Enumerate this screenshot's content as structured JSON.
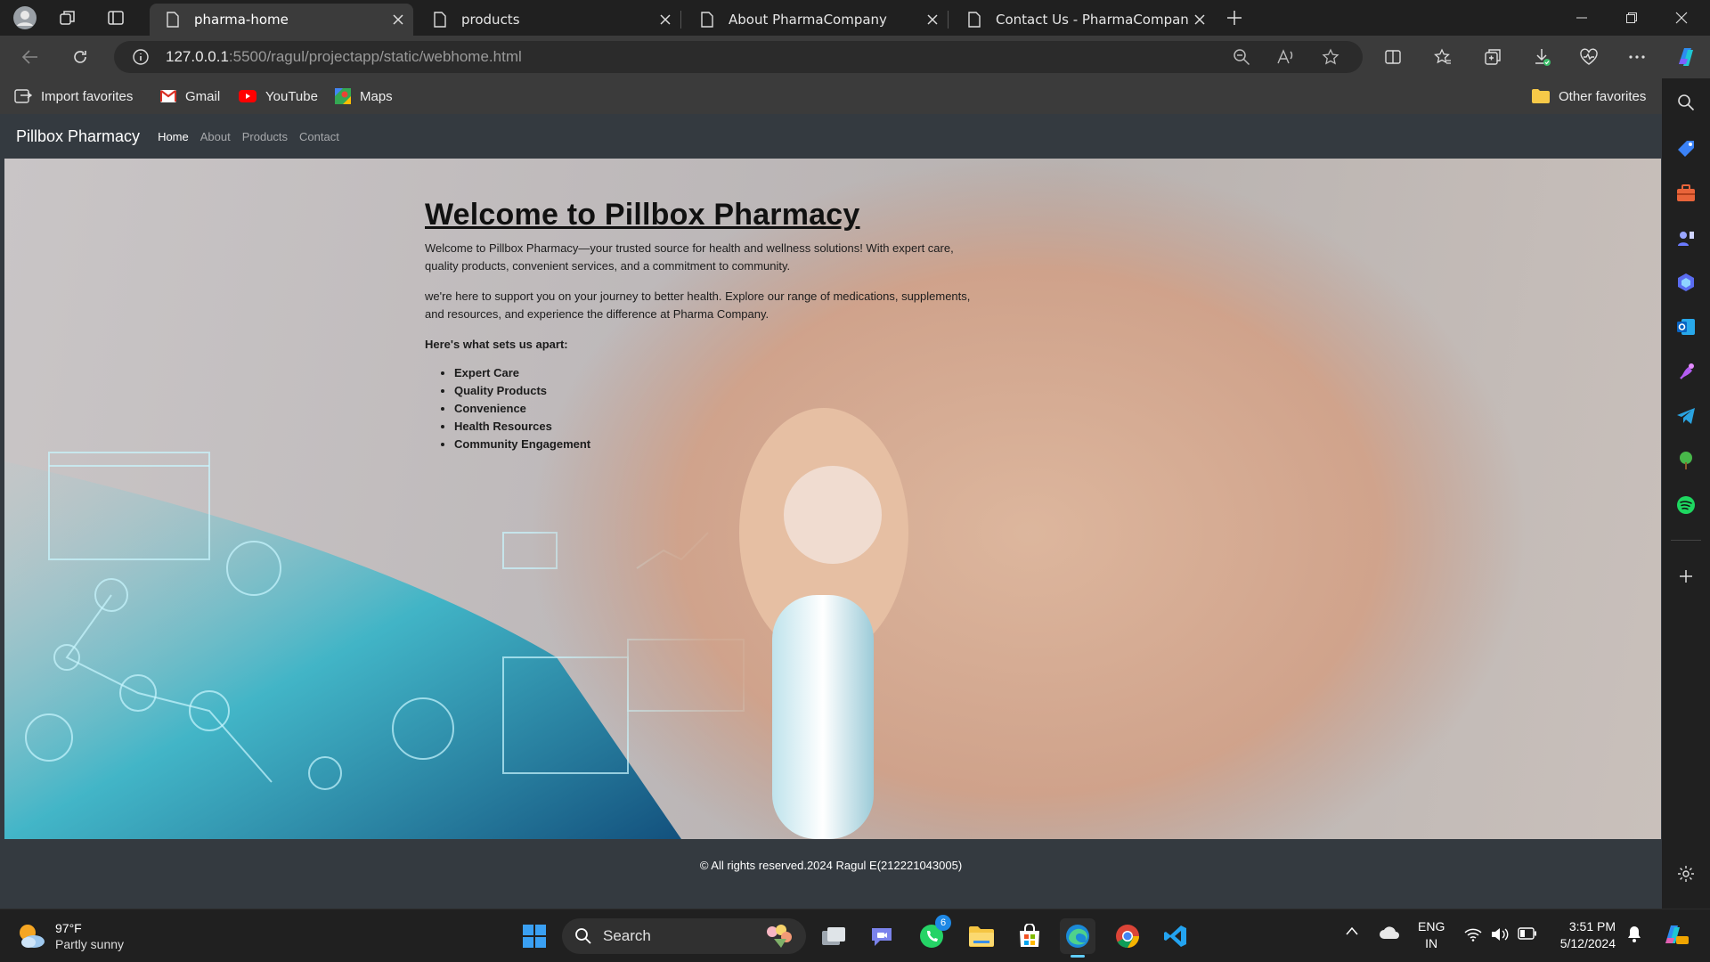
{
  "browser": {
    "tabs": [
      {
        "title": "pharma-home",
        "active": true
      },
      {
        "title": "products",
        "active": false
      },
      {
        "title": "About PharmaCompany",
        "active": false
      },
      {
        "title": "Contact Us - PharmaCompany",
        "active": false
      }
    ],
    "url_host": "127.0.0.1",
    "url_path": ":5500/ragul/projectapp/static/webhome.html",
    "favorites": {
      "import": "Import favorites",
      "gmail": "Gmail",
      "youtube": "YouTube",
      "maps": "Maps",
      "other": "Other favorites"
    }
  },
  "site": {
    "brand": "Pillbox Pharmacy",
    "nav": [
      "Home",
      "About",
      "Products",
      "Contact"
    ],
    "heading": "Welcome to Pillbox Pharmacy",
    "paragraph1": "Welcome to Pillbox Pharmacy—your trusted source for health and wellness solutions! With expert care, quality products, convenient services, and a commitment to community.",
    "paragraph2": "we're here to support you on your journey to better health. Explore our range of medications, supplements, and resources, and experience the difference at Pharma Company.",
    "apart_title": "Here's what sets us apart:",
    "features": [
      "Expert Care",
      "Quality Products",
      "Convenience",
      "Health Resources",
      "Community Engagement"
    ],
    "footer": "© All rights reserved.2024 Ragul E(212221043005)"
  },
  "taskbar": {
    "temperature": "97°F",
    "weather": "Partly sunny",
    "search": "Search",
    "whatsapp_badge": "6",
    "lang": "ENG",
    "region": "IN",
    "time": "3:51 PM",
    "date": "5/12/2024"
  },
  "colors": {
    "browser_bg": "#202020",
    "toolbar_bg": "#3b3b3b",
    "navbar_bg": "#343a40",
    "accent": "#1a8cff"
  }
}
